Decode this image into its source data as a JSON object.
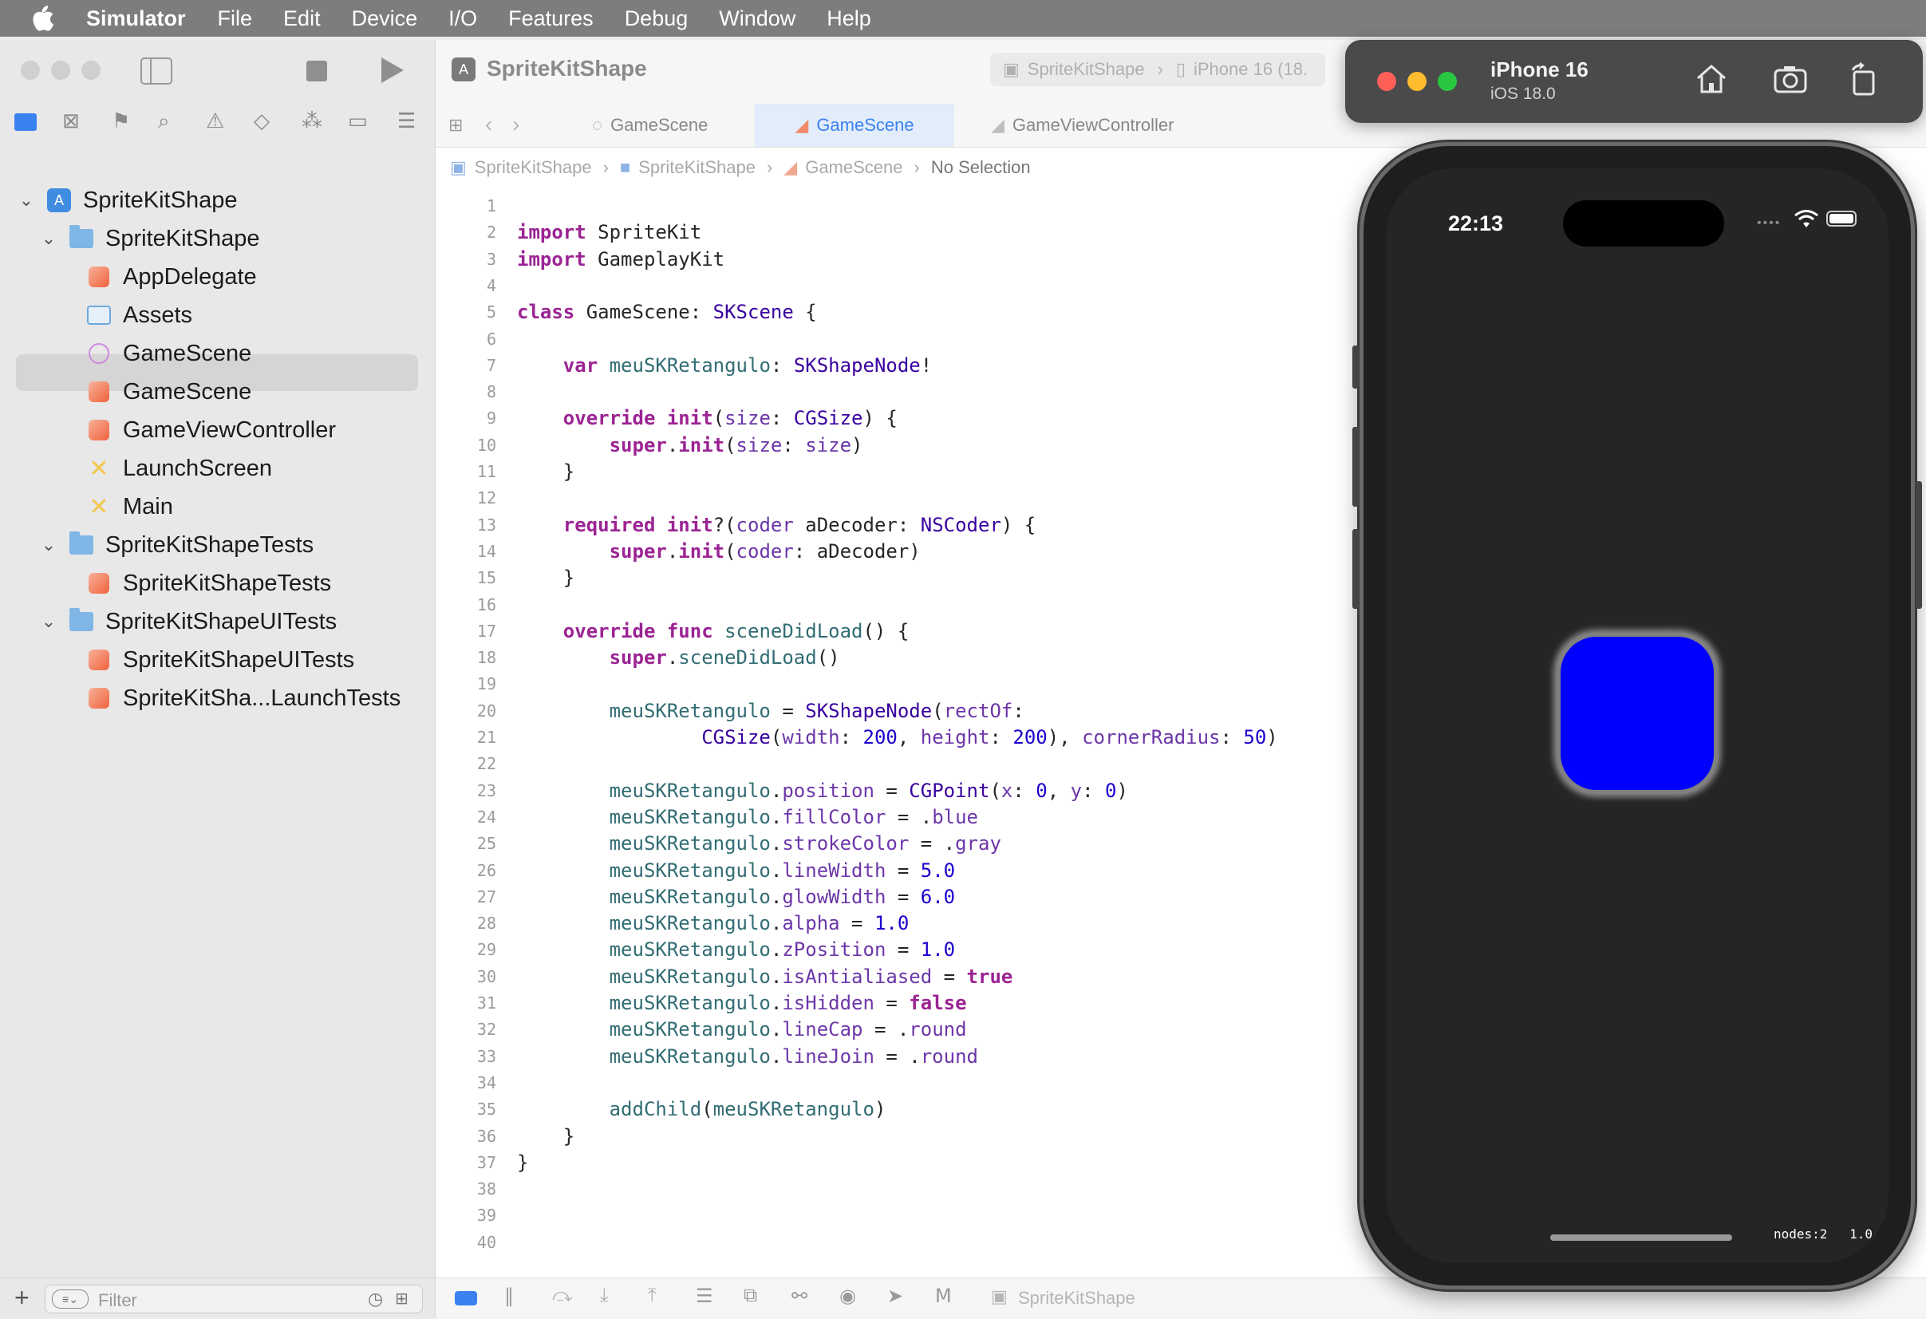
{
  "menubar": {
    "app_name": "Simulator",
    "items": [
      "File",
      "Edit",
      "Device",
      "I/O",
      "Features",
      "Debug",
      "Window",
      "Help"
    ]
  },
  "xcode": {
    "title": "SpriteKitShape",
    "scheme": {
      "target": "SpriteKitShape",
      "device": "iPhone 16 (18."
    },
    "tabs": [
      {
        "label": "GameScene",
        "active": false
      },
      {
        "label": "GameScene",
        "active": true
      },
      {
        "label": "GameViewController",
        "active": false
      }
    ],
    "jumpbar": [
      "SpriteKitShape",
      "SpriteKitShape",
      "GameScene",
      "No Selection"
    ],
    "navigator": {
      "filter_placeholder": "Filter",
      "tree": [
        {
          "label": "SpriteKitShape",
          "kind": "project",
          "depth": 0,
          "expanded": true
        },
        {
          "label": "SpriteKitShape",
          "kind": "folder",
          "depth": 1,
          "expanded": true
        },
        {
          "label": "AppDelegate",
          "kind": "swift",
          "depth": 2
        },
        {
          "label": "Assets",
          "kind": "assets",
          "depth": 2
        },
        {
          "label": "GameScene",
          "kind": "sks",
          "depth": 2
        },
        {
          "label": "GameScene",
          "kind": "swift",
          "depth": 2,
          "selected": true
        },
        {
          "label": "GameViewController",
          "kind": "swift",
          "depth": 2
        },
        {
          "label": "LaunchScreen",
          "kind": "storyboard",
          "depth": 2
        },
        {
          "label": "Main",
          "kind": "storyboard",
          "depth": 2
        },
        {
          "label": "SpriteKitShapeTests",
          "kind": "folder",
          "depth": 1,
          "expanded": true
        },
        {
          "label": "SpriteKitShapeTests",
          "kind": "swift",
          "depth": 2
        },
        {
          "label": "SpriteKitShapeUITests",
          "kind": "folder",
          "depth": 1,
          "expanded": true
        },
        {
          "label": "SpriteKitShapeUITests",
          "kind": "swift",
          "depth": 2
        },
        {
          "label": "SpriteKitSha...LaunchTests",
          "kind": "swift",
          "depth": 2
        }
      ]
    },
    "code_lines": [
      "",
      "import SpriteKit",
      "import GameplayKit",
      "",
      "class GameScene: SKScene {",
      "",
      "    var meuSKRetangulo: SKShapeNode!",
      "",
      "    override init(size: CGSize) {",
      "        super.init(size: size)",
      "    }",
      "",
      "    required init?(coder aDecoder: NSCoder) {",
      "        super.init(coder: aDecoder)",
      "    }",
      "",
      "    override func sceneDidLoad() {",
      "        super.sceneDidLoad()",
      "",
      "        meuSKRetangulo = SKShapeNode(rectOf:",
      "                CGSize(width: 200, height: 200), cornerRadius: 50)",
      "",
      "        meuSKRetangulo.position = CGPoint(x: 0, y: 0)",
      "        meuSKRetangulo.fillColor = .blue",
      "        meuSKRetangulo.strokeColor = .gray",
      "        meuSKRetangulo.lineWidth = 5.0",
      "        meuSKRetangulo.glowWidth = 6.0",
      "        meuSKRetangulo.alpha = 1.0",
      "        meuSKRetangulo.zPosition = 1.0",
      "        meuSKRetangulo.isAntialiased = true",
      "        meuSKRetangulo.isHidden = false",
      "        meuSKRetangulo.lineCap = .round",
      "        meuSKRetangulo.lineJoin = .round",
      "",
      "        addChild(meuSKRetangulo)",
      "    }",
      "}",
      "",
      "",
      ""
    ],
    "debug_target": "SpriteKitShape"
  },
  "simulator": {
    "device_name": "iPhone 16",
    "os_version": "iOS 18.0",
    "status_time": "22:13",
    "scene_stats": {
      "nodes": "nodes:2",
      "fps": "1.0"
    },
    "shape_fill": "#0000ff",
    "shape_stroke": "#808080"
  }
}
